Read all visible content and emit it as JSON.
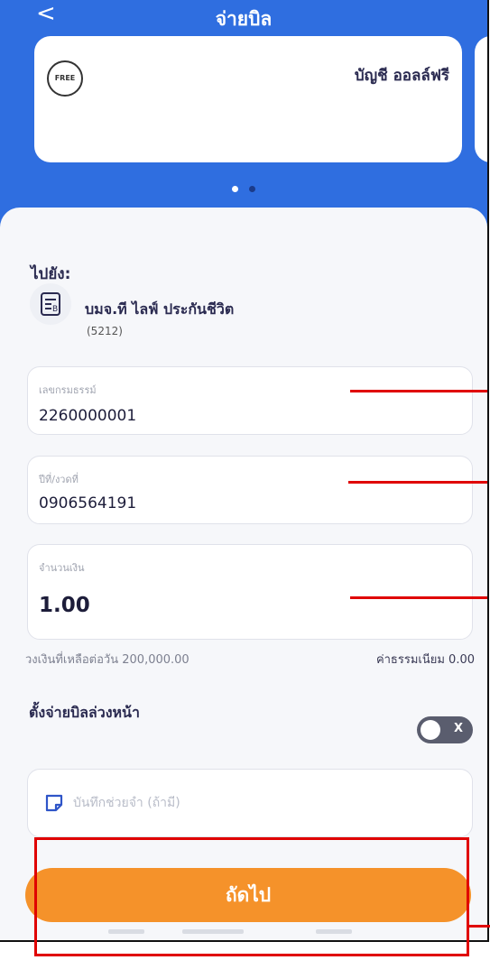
{
  "header": {
    "title": "จ่ายบิล",
    "back_icon": "<"
  },
  "account_card": {
    "badge": "FREE",
    "name": "บัญชี ออลล์ฟรี"
  },
  "carousel": {
    "count": 2,
    "active_index": 0
  },
  "payee": {
    "to_label": "ไปยัง:",
    "name": "บมจ.ที ไลฟ์ ประกันชีวิต",
    "code": "(5212)"
  },
  "fields": {
    "reference": {
      "label": "เลขกรมธรรม์",
      "value": "2260000001"
    },
    "reference2": {
      "label": "ปีที่/งวดที่",
      "value": "0906564191"
    },
    "amount": {
      "label": "จำนวนเงิน",
      "value": "1.00"
    }
  },
  "limit_text": "วงเงินที่เหลือต่อวัน 200,000.00",
  "fee_text": "ค่าธรรมเนียม 0.00",
  "schedule": {
    "label": "ตั้งจ่ายบิลล่วงหน้า",
    "enabled": false,
    "toggle_mark": "X"
  },
  "note": {
    "placeholder": "บันทึกช่วยจำ (ถ้ามี)"
  },
  "next_button": {
    "label": "ถัดไป"
  },
  "colors": {
    "header_blue": "#2f6ee0",
    "button_orange": "#f5922a",
    "annotation_red": "#e00000",
    "toggle_off": "#5a5d6e"
  }
}
